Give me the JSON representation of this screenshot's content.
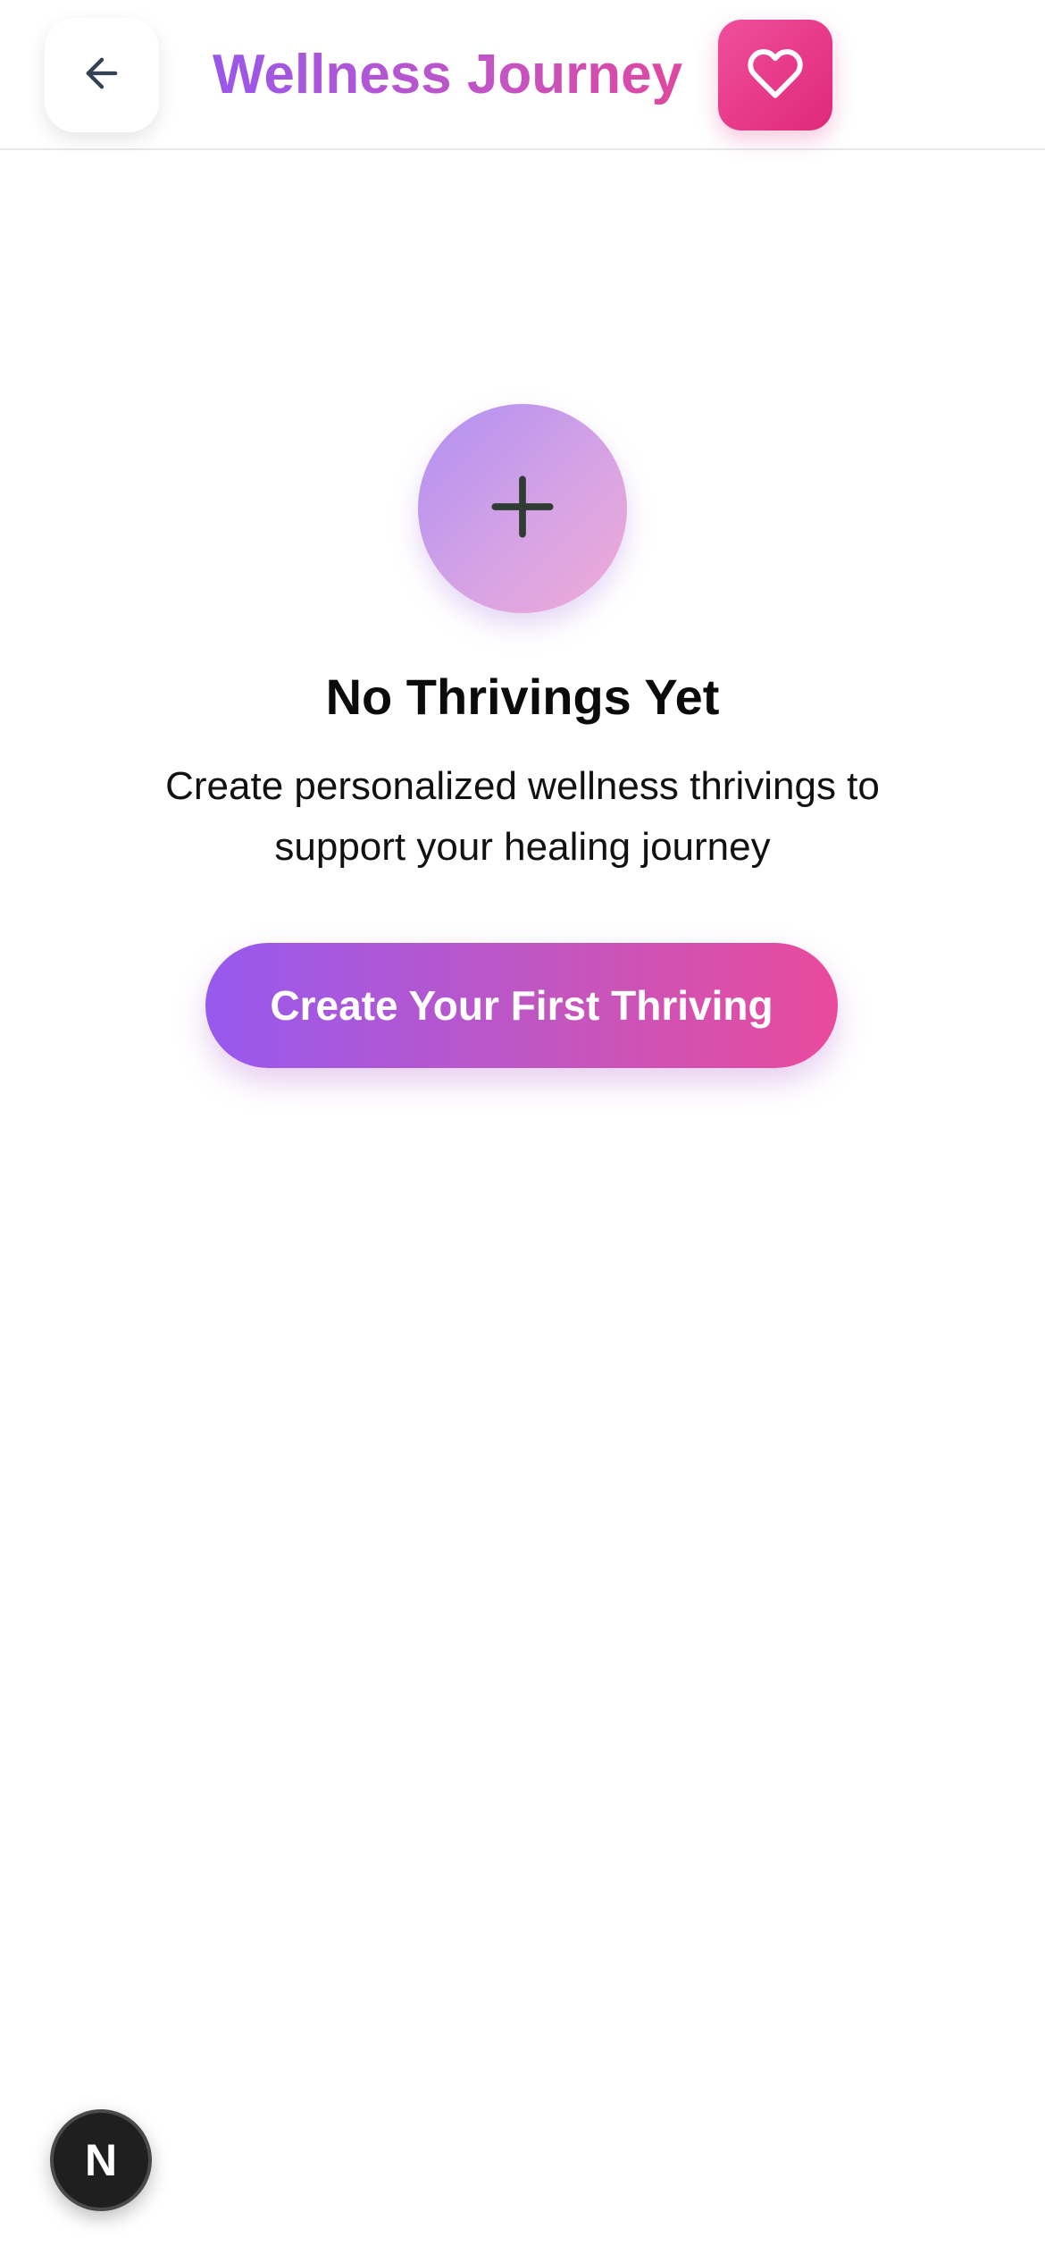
{
  "header": {
    "back_icon": "arrow-left-icon",
    "title": "Wellness Journey",
    "heart_icon": "heart-icon",
    "accent_gradient": [
      "#9a57ea",
      "#e0479e"
    ],
    "heart_button_color": "#e7337f"
  },
  "empty_state": {
    "icon": "plus-icon",
    "title": "No Thrivings Yet",
    "description": "Create personalized wellness thrivings to support your healing journey",
    "cta_label": "Create Your First Thriving"
  },
  "dev_badge": {
    "label": "N",
    "icon": "nextjs-logo-icon"
  }
}
